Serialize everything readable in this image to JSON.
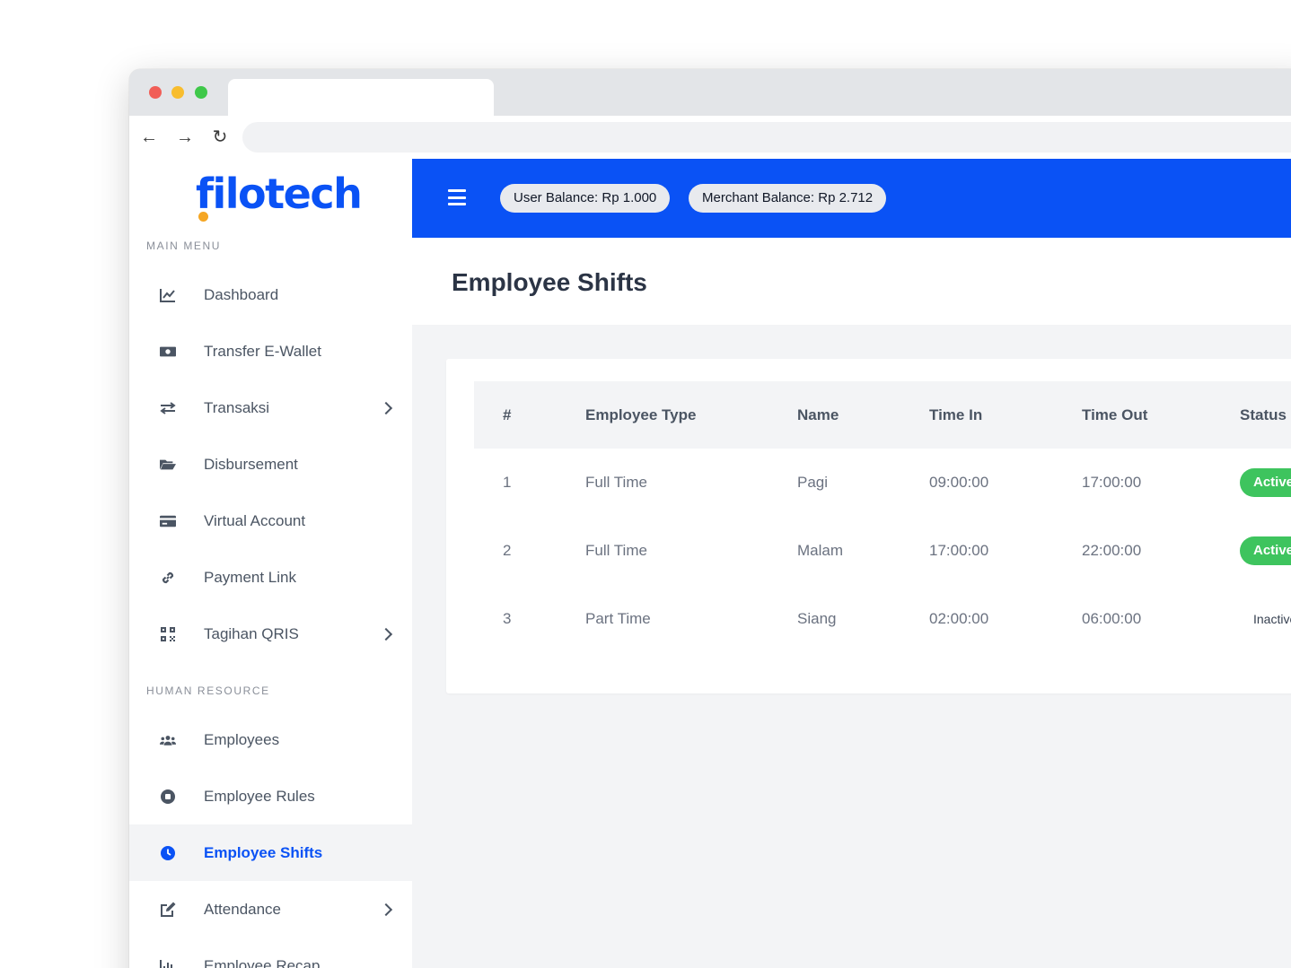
{
  "app": {
    "logo_text": "filotech",
    "brand_color": "#0a52f5",
    "accent_color": "#f5a623"
  },
  "sidebar": {
    "sections": [
      {
        "title": "MAIN MENU",
        "items": [
          {
            "label": "Dashboard",
            "icon": "chart-line-icon",
            "has_submenu": false
          },
          {
            "label": "Transfer E-Wallet",
            "icon": "money-bill-icon",
            "has_submenu": false
          },
          {
            "label": "Transaksi",
            "icon": "exchange-arrows-icon",
            "has_submenu": true
          },
          {
            "label": "Disbursement",
            "icon": "folder-open-icon",
            "has_submenu": false
          },
          {
            "label": "Virtual Account",
            "icon": "credit-card-icon",
            "has_submenu": false
          },
          {
            "label": "Payment Link",
            "icon": "link-icon",
            "has_submenu": false
          },
          {
            "label": "Tagihan QRIS",
            "icon": "qrcode-icon",
            "has_submenu": true
          }
        ]
      },
      {
        "title": "HUMAN RESOURCE",
        "items": [
          {
            "label": "Employees",
            "icon": "users-icon",
            "has_submenu": false
          },
          {
            "label": "Employee Rules",
            "icon": "circle-stop-icon",
            "has_submenu": false
          },
          {
            "label": "Employee Shifts",
            "icon": "clock-icon",
            "has_submenu": false,
            "active": true
          },
          {
            "label": "Attendance",
            "icon": "edit-icon",
            "has_submenu": true
          },
          {
            "label": "Employee Recap",
            "icon": "bar-chart-icon",
            "has_submenu": false
          }
        ]
      }
    ]
  },
  "topbar": {
    "user_balance": "User Balance: Rp 1.000",
    "merchant_balance": "Merchant Balance: Rp 2.712"
  },
  "page": {
    "title": "Employee Shifts"
  },
  "table": {
    "columns": [
      "#",
      "Employee Type",
      "Name",
      "Time In",
      "Time Out",
      "Status"
    ],
    "rows": [
      {
        "no": "1",
        "type": "Full Time",
        "name": "Pagi",
        "time_in": "09:00:00",
        "time_out": "17:00:00",
        "status": "Active"
      },
      {
        "no": "2",
        "type": "Full Time",
        "name": "Malam",
        "time_in": "17:00:00",
        "time_out": "22:00:00",
        "status": "Active"
      },
      {
        "no": "3",
        "type": "Part Time",
        "name": "Siang",
        "time_in": "02:00:00",
        "time_out": "06:00:00",
        "status": "Inactive"
      }
    ]
  }
}
